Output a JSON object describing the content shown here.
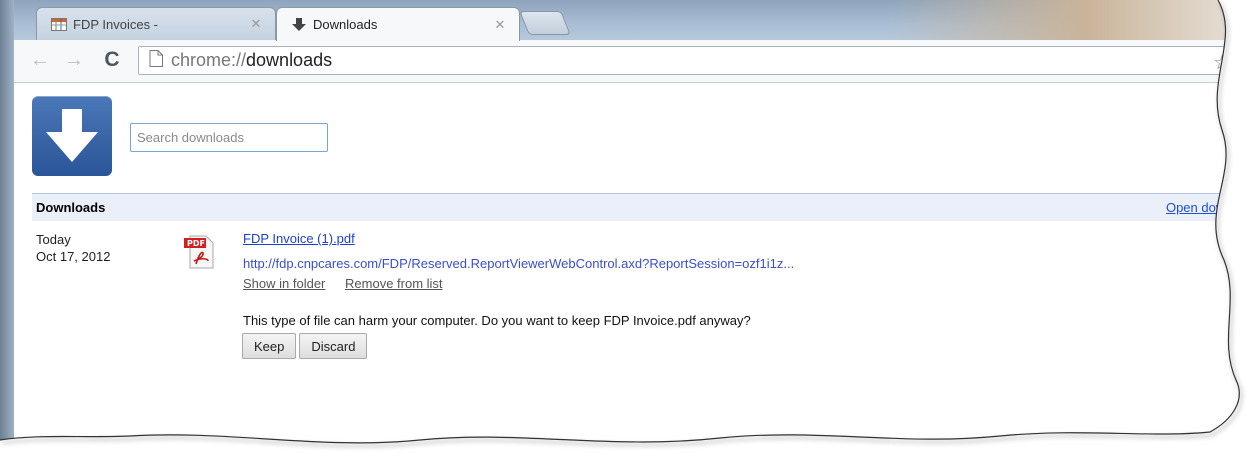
{
  "tabs": [
    {
      "title": "FDP Invoices -",
      "active": false,
      "icon": "table-icon"
    },
    {
      "title": "Downloads",
      "active": true,
      "icon": "download-arrow-icon"
    }
  ],
  "toolbar": {
    "url_scheme": "chrome://",
    "url_host": "downloads"
  },
  "page": {
    "search_placeholder": "Search downloads",
    "header_title": "Downloads",
    "open_folder_link": "Open downloads fo"
  },
  "download": {
    "day": "Today",
    "date": "Oct 17, 2012",
    "file_icon": "pdf-icon",
    "file_name": "FDP Invoice (1).pdf",
    "url": "http://fdp.cnpcares.com/FDP/Reserved.ReportViewerWebControl.axd?ReportSession=ozf1i1z...",
    "show_in_folder": "Show in folder",
    "remove_from_list": "Remove from list",
    "warning": "This type of file can harm your computer. Do you want to keep FDP Invoice.pdf anyway?",
    "keep_label": "Keep",
    "discard_label": "Discard"
  },
  "colors": {
    "link": "#1f3fcf",
    "header_bg": "#ebeff9",
    "logo_blue": "#2a5598"
  }
}
